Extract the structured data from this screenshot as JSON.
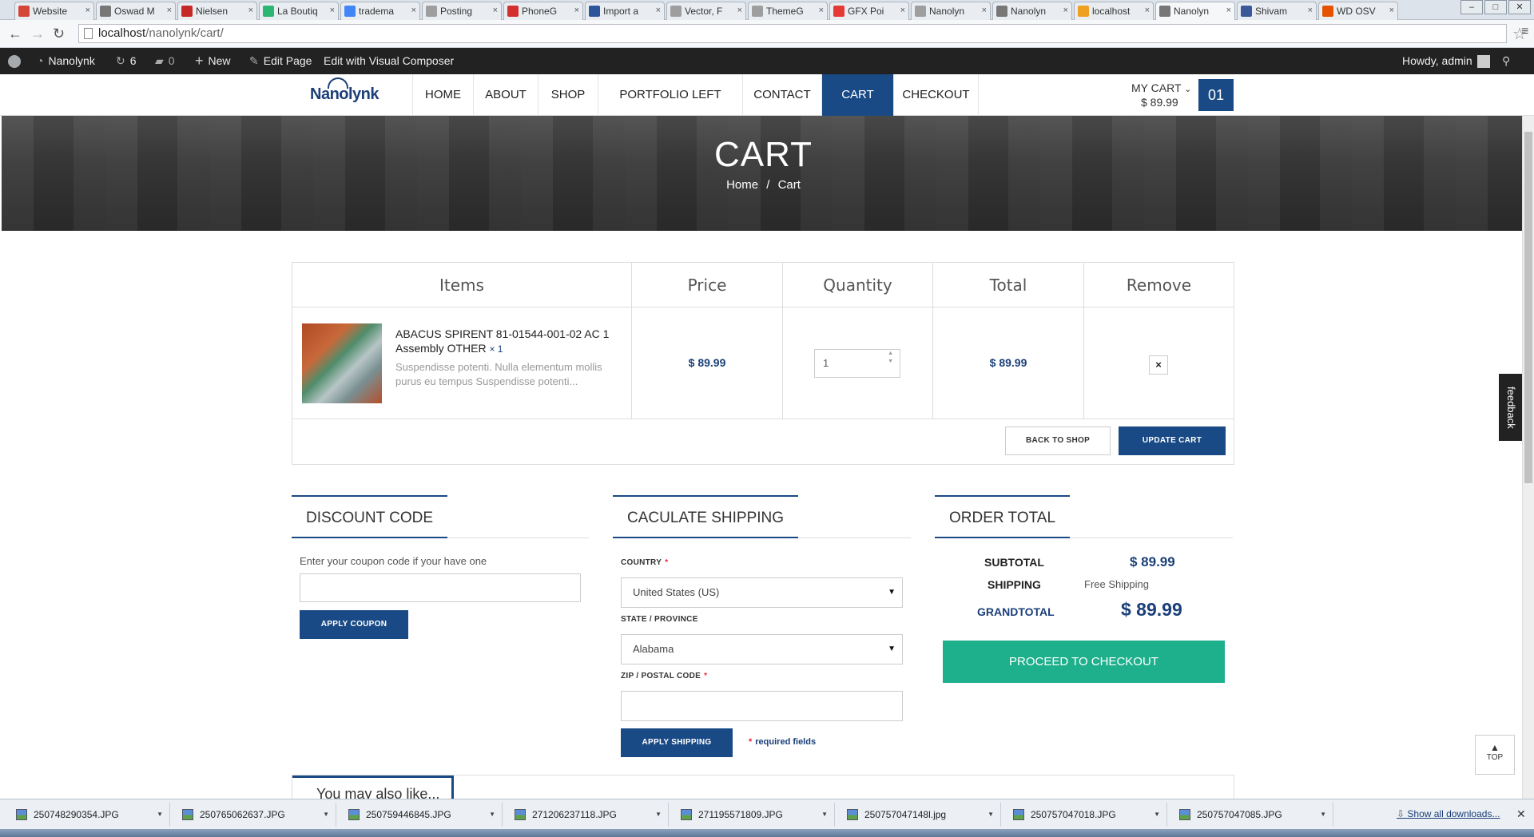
{
  "browser": {
    "tabs": [
      {
        "label": "Website",
        "icon": "gmail-icon",
        "color": "#d44638"
      },
      {
        "label": "Oswad M",
        "icon": "wordpress-icon",
        "color": "#777777"
      },
      {
        "label": "Nielsen",
        "icon": "nielsen-icon",
        "color": "#c62828"
      },
      {
        "label": "La Boutiq",
        "icon": "boutique-icon",
        "color": "#2bb673"
      },
      {
        "label": "tradema",
        "icon": "google-icon",
        "color": "#4285f4"
      },
      {
        "label": "Posting",
        "icon": "page-icon",
        "color": "#9e9e9e"
      },
      {
        "label": "PhoneG",
        "icon": "rc-icon",
        "color": "#d32f2f"
      },
      {
        "label": "Import a",
        "icon": "word-icon",
        "color": "#2b579a"
      },
      {
        "label": "Vector, F",
        "icon": "page-icon",
        "color": "#9e9e9e"
      },
      {
        "label": "ThemeG",
        "icon": "page-icon",
        "color": "#9e9e9e"
      },
      {
        "label": "GFX Poi",
        "icon": "gfx-icon",
        "color": "#e53935"
      },
      {
        "label": "Nanolyn",
        "icon": "page-icon",
        "color": "#9e9e9e"
      },
      {
        "label": "Nanolyn",
        "icon": "wordpress-icon",
        "color": "#777777"
      },
      {
        "label": "localhost",
        "icon": "pma-icon",
        "color": "#f0a020"
      },
      {
        "label": "Nanolyn",
        "icon": "wordpress-icon",
        "color": "#777777",
        "active": true
      },
      {
        "label": "Shivam",
        "icon": "facebook-icon",
        "color": "#3b5998"
      },
      {
        "label": "WD OSV",
        "icon": "wd-icon",
        "color": "#e65100"
      }
    ],
    "url_host": "localhost",
    "url_path": "/nanolynk/cart/"
  },
  "adminbar": {
    "site_name": "Nanolynk",
    "updates_count": "6",
    "comments_count": "0",
    "new_label": "New",
    "edit_page_label": "Edit Page",
    "visual_composer_label": "Edit with Visual Composer",
    "howdy": "Howdy, admin"
  },
  "header": {
    "logo_text": "Nanolynk",
    "nav": [
      "HOME",
      "ABOUT",
      "SHOP",
      "PORTFOLIO LEFT SIDEBAR",
      "CONTACT",
      "CART",
      "CHECKOUT"
    ],
    "active_nav": "CART",
    "my_cart_label": "MY CART",
    "my_cart_total": "$ 89.99",
    "cart_count": "01"
  },
  "banner": {
    "title": "CART",
    "crumb_home": "Home",
    "crumb_sep": "/",
    "crumb_current": "Cart"
  },
  "cart_table": {
    "headers": [
      "Items",
      "Price",
      "Quantity",
      "Total",
      "Remove"
    ],
    "item": {
      "name": "ABACUS SPIRENT 81-01544-001-02 AC 1 Assembly OTHER",
      "qty_suffix": "× 1",
      "desc": "Suspendisse potenti. Nulla elementum mollis purus eu tempus Suspendisse potenti...",
      "price": "$ 89.99",
      "quantity": "1",
      "total": "$ 89.99",
      "remove": "×"
    },
    "back_to_shop": "BACK TO SHOP",
    "update_cart": "UPDATE CART"
  },
  "discount": {
    "title": "DISCOUNT CODE",
    "hint": "Enter your coupon code if your have one",
    "coupon_value": "",
    "apply": "APPLY COUPON"
  },
  "shipping": {
    "title": "CACULATE SHIPPING",
    "country_label": "COUNTRY",
    "country_value": "United States (US)",
    "state_label": "STATE / PROVINCE",
    "state_value": "Alabama",
    "zip_label": "ZIP / POSTAL CODE",
    "zip_value": "",
    "required_star": "*",
    "apply": "APPLY SHIPPING",
    "required_note": "required fields"
  },
  "order_total": {
    "title": "ORDER TOTAL",
    "subtotal_label": "SUBTOTAL",
    "subtotal_value": "$ 89.99",
    "shipping_label": "SHIPPING",
    "shipping_value": "Free Shipping",
    "grand_label": "GRANDTOTAL",
    "grand_value": "$ 89.99",
    "checkout": "PROCEED TO CHECKOUT"
  },
  "also_like": "You may also like...",
  "feedback": "feedback",
  "top": "TOP",
  "downloads": {
    "items": [
      "250748290354.JPG",
      "250765062637.JPG",
      "250759446845.JPG",
      "271206237118.JPG",
      "271195571809.JPG",
      "250757047148l.jpg",
      "250757047018.JPG",
      "250757047085.JPG"
    ],
    "show_all": "Show all downloads..."
  },
  "colors": {
    "brand": "#1a4a85",
    "checkout": "#1eb08c",
    "price": "#1a3f78"
  }
}
